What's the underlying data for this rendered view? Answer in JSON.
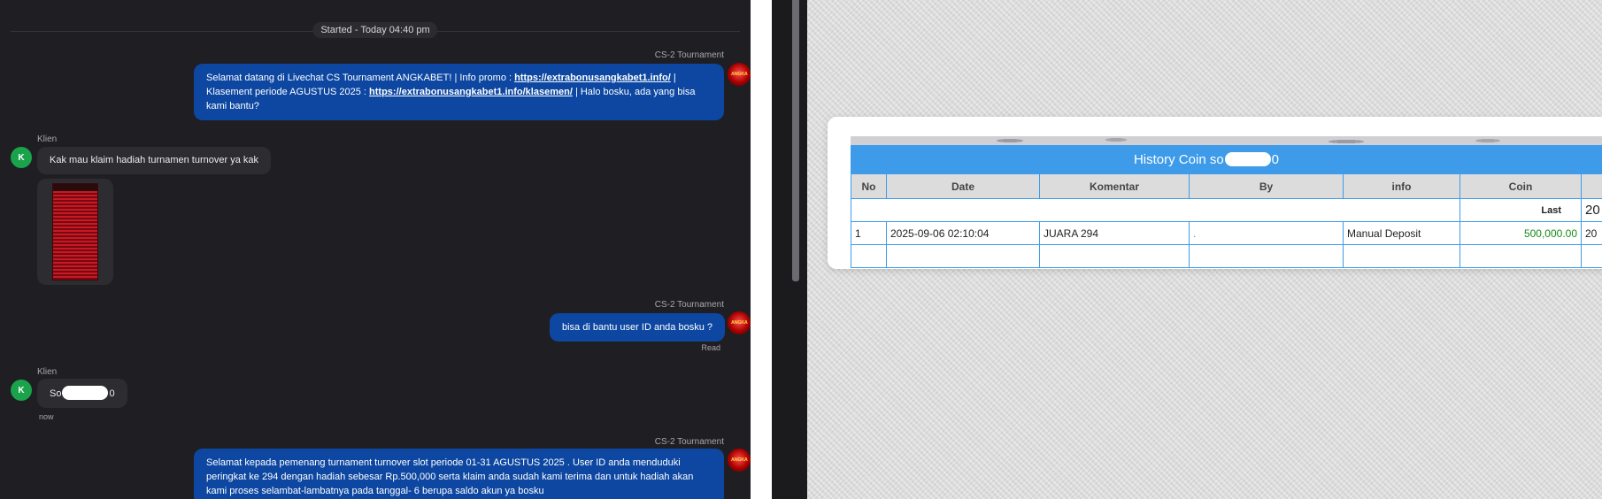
{
  "chat": {
    "started": "Started - Today 04:40 pm",
    "agent_name": "CS-2 Tournament",
    "client_name": "Klien",
    "client_initial": "K",
    "avatar_logo_text": "ANGKA",
    "messages": {
      "m1_pre": "Selamat datang di Livechat CS Tournament ANGKABET! | Info promo : ",
      "m1_link1": "https://extrabonusangkabet1.info/",
      "m1_mid": " | Klasement periode AGUSTUS 2025 : ",
      "m1_link2": "https://extrabonusangkabet1.info/klasemen/",
      "m1_post": " | Halo bosku, ada yang bisa kami bantu?",
      "m2": "Kak mau klaim hadiah turnamen turnover ya kak",
      "m3": "bisa di bantu user ID anda bosku ?",
      "m3_status": "Read",
      "m4_pre": "So",
      "m4_post": "0",
      "m4_time": "now",
      "m5": "Selamat kepada pemenang turnament turnover slot periode 01-31 AGUSTUS 2025 . User ID anda menduduki peringkat ke 294 dengan hadiah sebesar Rp.500,000 serta klaim anda sudah kami terima dan untuk hadiah akan kami proses selambat-lambatnya pada tanggal- 6 berupa saldo akun ya bosku"
    }
  },
  "history": {
    "title_pre": "History Coin so",
    "title_post": "0",
    "columns": [
      "No",
      "Date",
      "Komentar",
      "By",
      "info",
      "Coin",
      ""
    ],
    "last_label": "Last",
    "last_value": "20",
    "rows": [
      {
        "no": "1",
        "date": "2025-09-06 02:10:04",
        "komentar": "JUARA 294",
        "by": ".",
        "info": "Manual Deposit",
        "coin": "500,000.00",
        "extra": "20"
      }
    ]
  },
  "colors": {
    "agent_bubble": "#0d47a1",
    "client_bubble": "#2c2c31",
    "client_avatar": "#1aa34a",
    "table_header": "#3d9be9",
    "coin_text": "#1a8a1a"
  }
}
